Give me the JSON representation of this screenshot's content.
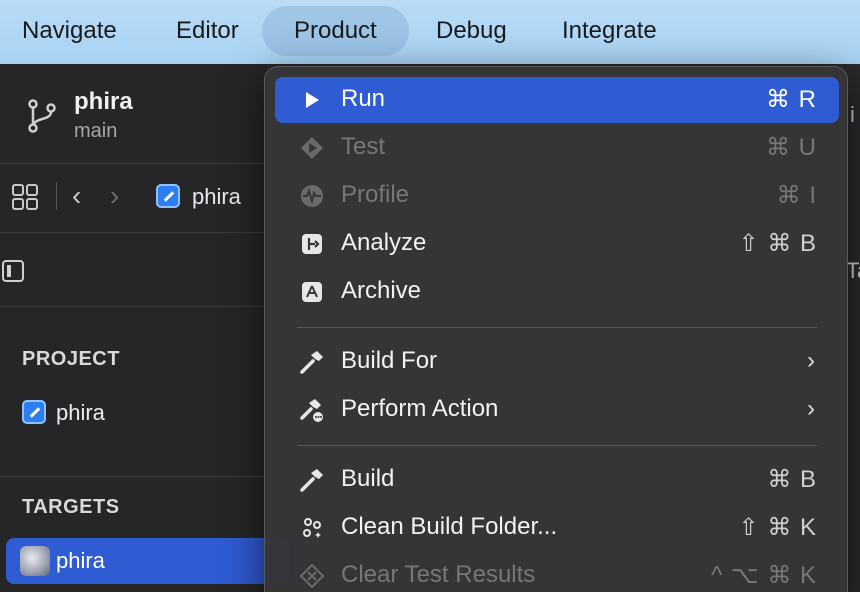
{
  "menubar": {
    "items": [
      "Navigate",
      "Editor",
      "Product",
      "Debug",
      "Integrate"
    ],
    "active": "Product"
  },
  "sidebar": {
    "project_name": "phira",
    "branch": "main",
    "breadcrumb": "phira",
    "sections": {
      "project_header": "PROJECT",
      "project_item": "phira",
      "targets_header": "TARGETS",
      "target_item": "phira"
    }
  },
  "right_fragments": {
    "top": "i",
    "mid": "Ta"
  },
  "menu": {
    "items": [
      {
        "label": "Run",
        "shortcut": "⌘ R",
        "icon": "play-icon"
      },
      {
        "label": "Test",
        "shortcut": "⌘ U",
        "icon": "test-diamond-icon"
      },
      {
        "label": "Profile",
        "shortcut": "⌘ I",
        "icon": "profile-waveform-icon"
      },
      {
        "label": "Analyze",
        "shortcut": "⇧ ⌘ B",
        "icon": "analyze-icon"
      },
      {
        "label": "Archive",
        "shortcut": "",
        "icon": "archive-icon"
      },
      {
        "label": "Build For",
        "shortcut": "",
        "icon": "hammer-icon"
      },
      {
        "label": "Perform Action",
        "shortcut": "",
        "icon": "hammer-action-icon"
      },
      {
        "label": "Build",
        "shortcut": "⌘ B",
        "icon": "hammer-icon"
      },
      {
        "label": "Clean Build Folder...",
        "shortcut": "⇧ ⌘ K",
        "icon": "clean-sparkle-icon"
      },
      {
        "label": "Clear Test Results",
        "shortcut": "^ ⌥ ⌘ K",
        "icon": "clear-results-icon"
      }
    ]
  },
  "colors": {
    "highlight": "#2f5bd3",
    "menubar": "#b1d7f5",
    "menu_bg": "#363638"
  }
}
